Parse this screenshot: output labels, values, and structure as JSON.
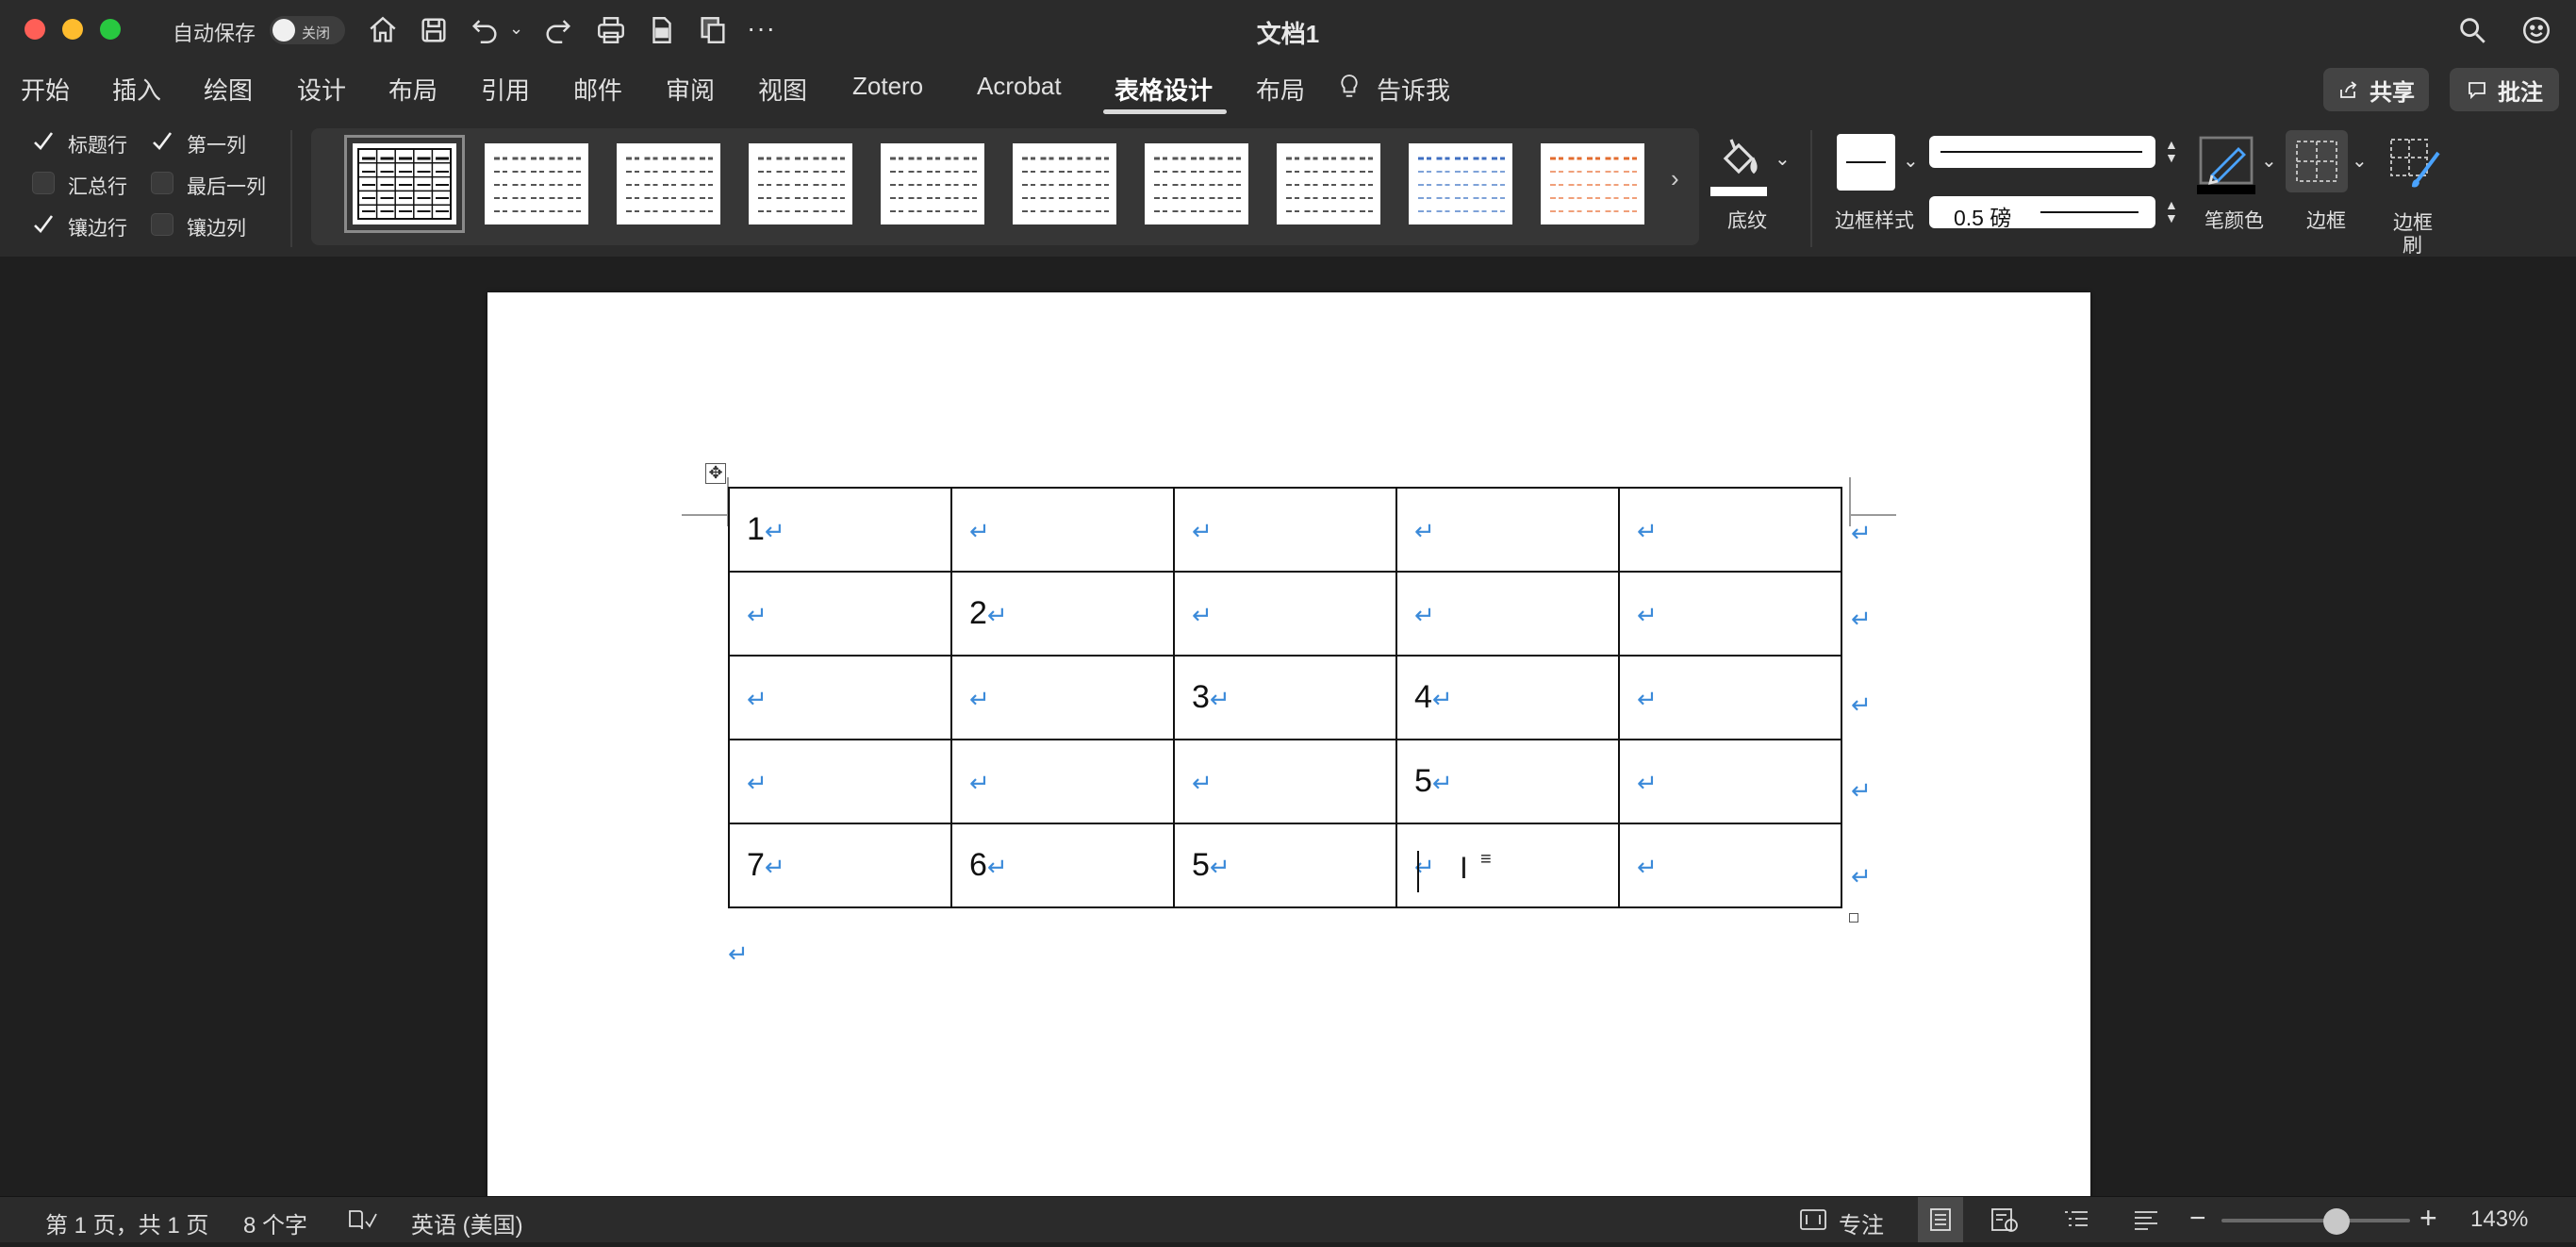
{
  "window": {
    "title": "文档1",
    "autosave_label": "自动保存",
    "autosave_state": "关闭"
  },
  "ribbon_tabs": [
    "开始",
    "插入",
    "绘图",
    "设计",
    "布局",
    "引用",
    "邮件",
    "审阅",
    "视图",
    "Zotero",
    "Acrobat",
    "表格设计",
    "布局",
    "告诉我"
  ],
  "active_tab": "表格设计",
  "share_label": "共享",
  "comments_label": "批注",
  "style_options": {
    "header_row": "标题行",
    "total_row": "汇总行",
    "banded_rows": "镶边行",
    "first_column": "第一列",
    "last_column": "最后一列",
    "banded_columns": "镶边列"
  },
  "style_options_checked": {
    "header_row": true,
    "total_row": false,
    "banded_rows": true,
    "first_column": true,
    "last_column": false,
    "banded_columns": false
  },
  "table_style_variants": [
    "grid-dark",
    "plain",
    "plain",
    "plain",
    "plain",
    "plain",
    "plain",
    "plain",
    "blue-accent",
    "orange-accent"
  ],
  "shading_label": "底纹",
  "border_styles_label": "边框样式",
  "line_weight": "0.5 磅",
  "pen_color_label": "笔颜色",
  "borders_label": "边框",
  "border_painter_label": "边框\n刷",
  "border_painter_line1": "边框",
  "border_painter_line2": "刷",
  "document_table": [
    [
      "1",
      "",
      "",
      "",
      ""
    ],
    [
      "",
      "2",
      "",
      "",
      ""
    ],
    [
      "",
      "",
      "3",
      "4",
      ""
    ],
    [
      "",
      "",
      "",
      "5",
      ""
    ],
    [
      "7",
      "6",
      "5",
      "",
      ""
    ]
  ],
  "paragraph_mark": "↵",
  "status": {
    "page": "第 1 页，共 1 页",
    "words": "8 个字",
    "language": "英语 (美国)",
    "focus": "专注",
    "zoom": "143%"
  },
  "zoom_percent": 143,
  "colors": {
    "chrome": "#2b2b2b",
    "canvas": "#1f1f1f",
    "paragraph_mark": "#3b8ad9",
    "close": "#ff5f57",
    "minimize": "#febc2e",
    "zoom": "#28c840"
  }
}
